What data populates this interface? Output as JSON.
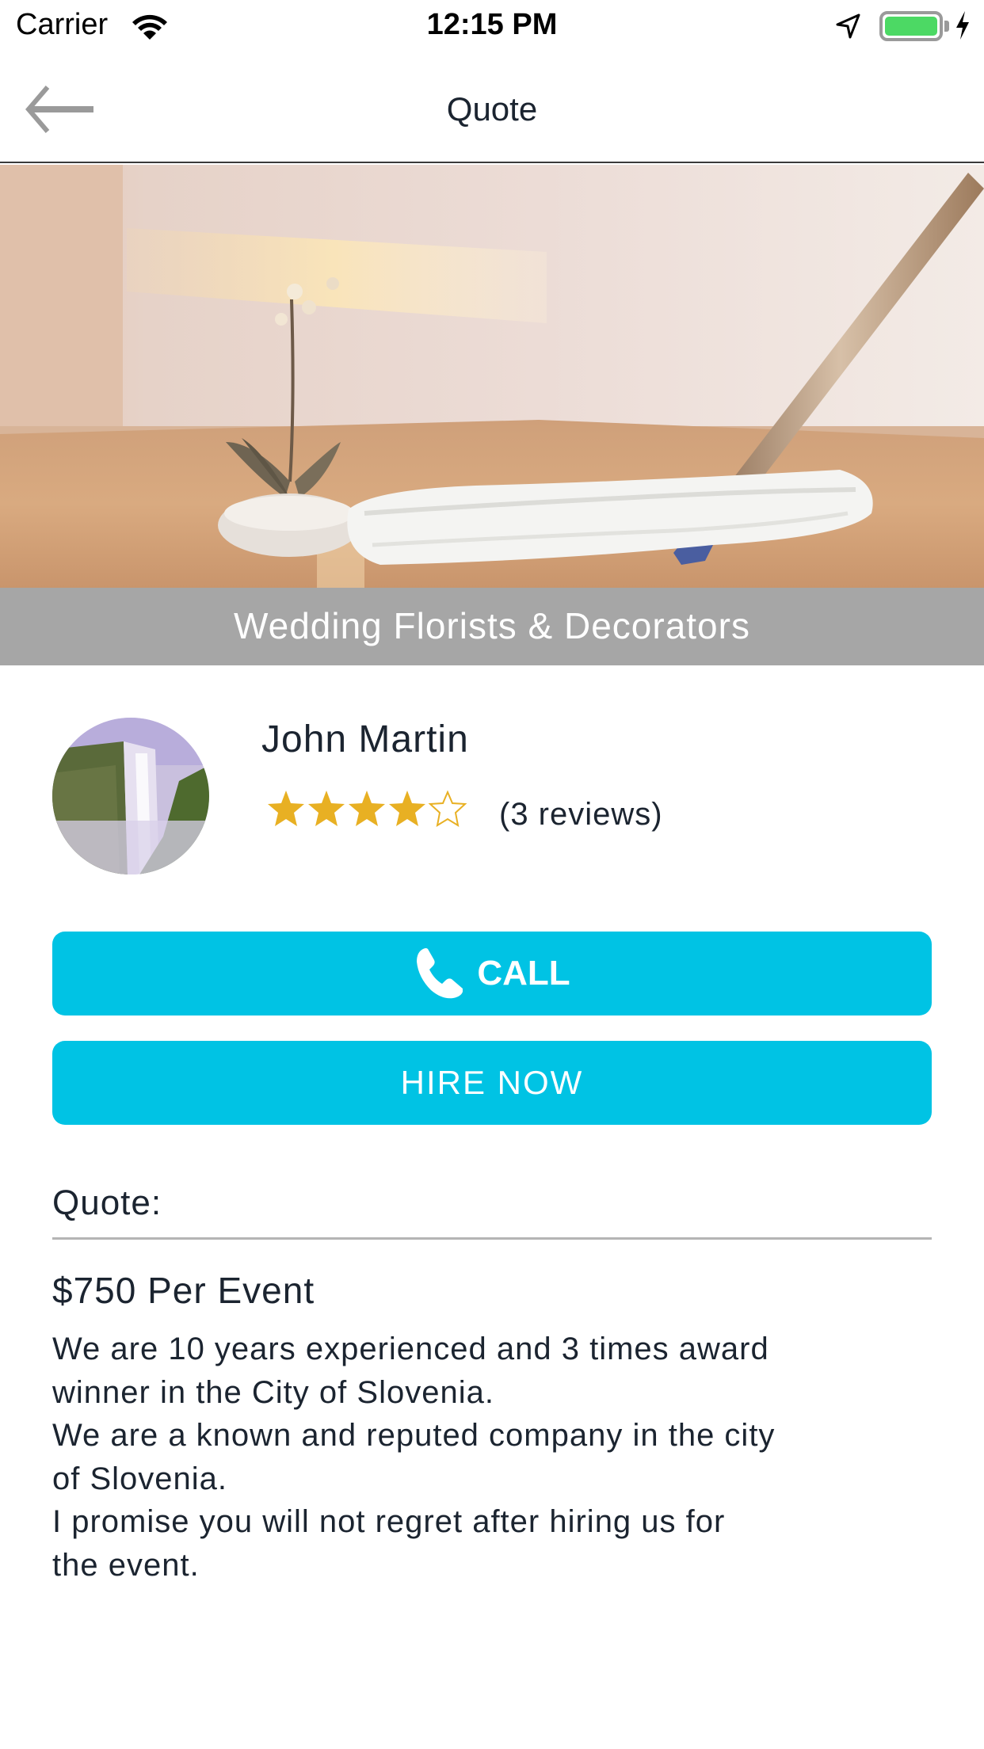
{
  "status_bar": {
    "carrier": "Carrier",
    "time": "12:15 PM",
    "battery_color": "#4cd964",
    "icons": [
      "wifi-icon",
      "location-arrow-icon",
      "battery-icon",
      "charging-bolt-icon"
    ]
  },
  "nav": {
    "title": "Quote",
    "back_icon": "arrow-left-icon"
  },
  "hero": {
    "image_description": "mop cleaning wooden floor with orchid in vase",
    "category": "Wedding Florists & Decorators"
  },
  "provider": {
    "name": "John Martin",
    "avatar_description": "waterfall landscape",
    "rating": 4,
    "rating_max": 5,
    "reviews_text": "(3 reviews)",
    "star_color": "#e8b023"
  },
  "actions": {
    "call_label": "CALL",
    "call_icon": "phone-icon",
    "hire_label": "HIRE NOW",
    "accent_color": "#00c3e4"
  },
  "quote": {
    "label": "Quote:",
    "price": "$750 Per Event",
    "description_lines": [
      "We are 10 years experienced and 3 times award",
      "winner in the City of Slovenia.",
      "We are a known and reputed company in the city",
      "of Slovenia.",
      "I promise you will not regret after hiring us for",
      "the event."
    ]
  }
}
